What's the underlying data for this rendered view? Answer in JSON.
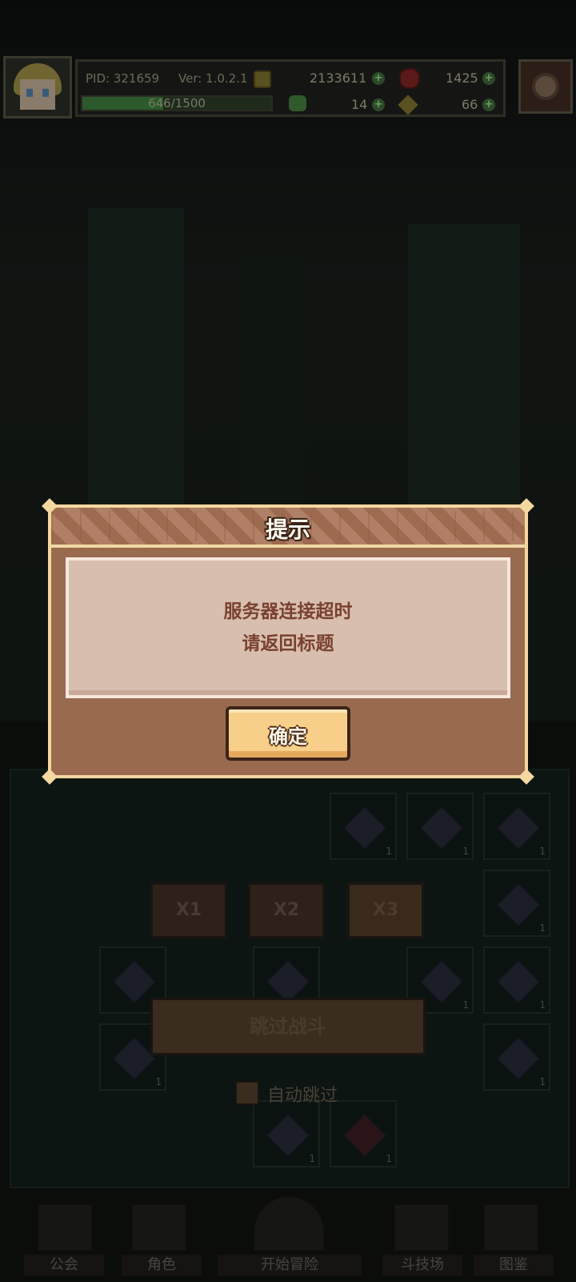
{
  "topbar": {
    "pid": "PID: 321659",
    "version": "Ver: 1.0.2.1",
    "gold": "2133611",
    "gems": "1425",
    "clovers": "14",
    "keys": "66",
    "xp_text": "646/1500",
    "xp_progress": 0.43
  },
  "battle": {
    "speed_x1": "X1",
    "speed_x2": "X2",
    "speed_x3": "X3",
    "skip_battle": "跳过战斗",
    "auto_skip": "自动跳过",
    "slot_count": "1"
  },
  "nav": {
    "guild": "公会",
    "character": "角色",
    "start_adventure": "开始冒险",
    "arena": "斗技场",
    "collection": "图鉴"
  },
  "dialog": {
    "title": "提示",
    "message_line1": "服务器连接超时",
    "message_line2": "请返回标题",
    "confirm": "确定"
  },
  "colors": {
    "dialog_bg": "#9a6a4f",
    "dialog_border": "#f5d7a0",
    "body_bg": "#d8beae",
    "message_text": "#7a4030",
    "button_bg": "#f7cf88"
  }
}
